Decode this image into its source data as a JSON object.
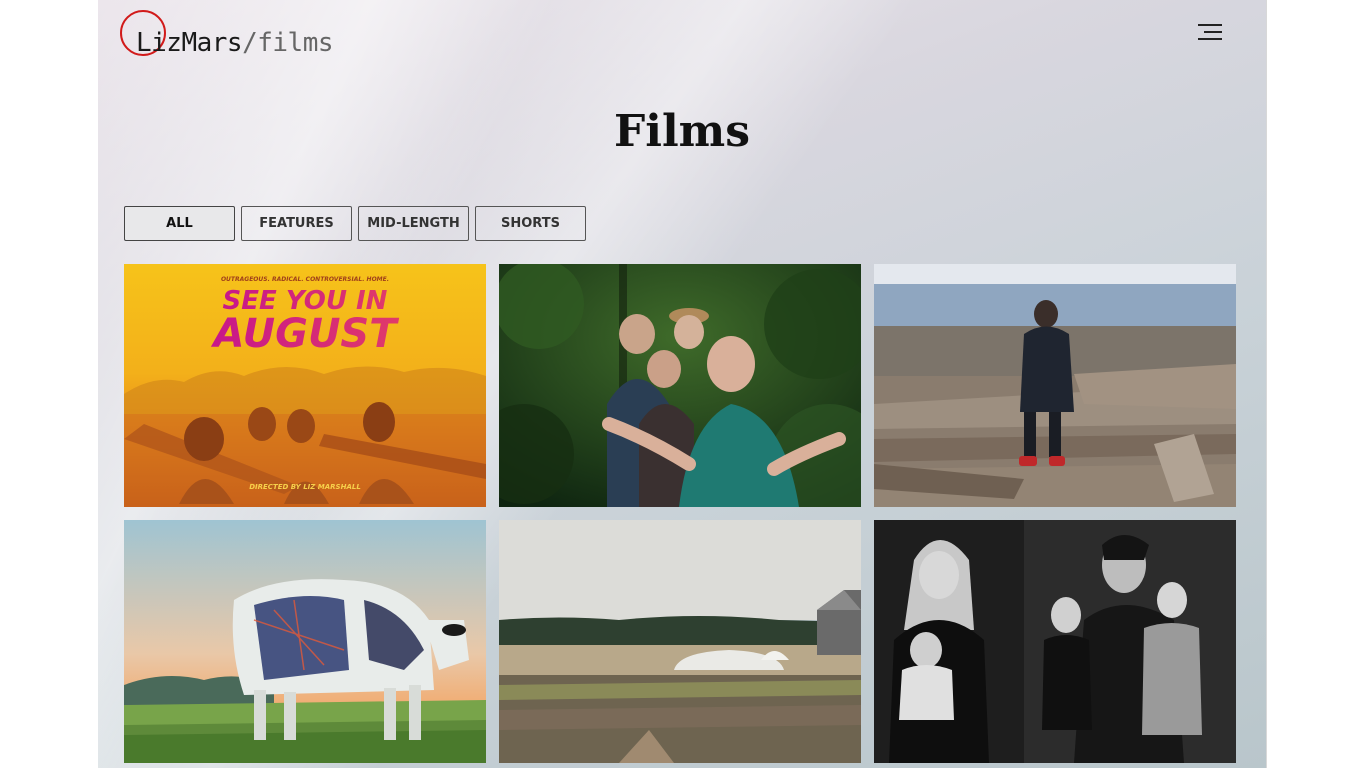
{
  "header": {
    "logo_text": "LizMars",
    "logo_sub": "/films",
    "menu_icon": "hamburger-menu-icon",
    "logo_ring_color": "#d11a1a"
  },
  "page": {
    "title": "Films"
  },
  "filters": [
    {
      "label": "ALL",
      "active": true
    },
    {
      "label": "FEATURES",
      "active": false
    },
    {
      "label": "MID-LENGTH",
      "active": false
    },
    {
      "label": "SHORTS",
      "active": false
    }
  ],
  "films": [
    {
      "poster_tagline": "OUTRAGEOUS. RADICAL. CONTROVERSIAL. HOME.",
      "poster_title_line1": "SEE YOU IN",
      "poster_title_line2": "AUGUST",
      "poster_credit": "DIRECTED BY LIZ MARSHALL",
      "description": "yellow-tinted poster of teenagers lying in canoes"
    },
    {
      "description": "elderly people in a forest, man with outstretched hands"
    },
    {
      "description": "person standing on driftwood logs on a rocky beach"
    },
    {
      "description": "cow painted with a star map standing in a grassy field at sunset"
    },
    {
      "description": "farm field with greenhouses and a barn"
    },
    {
      "description": "black and white family portrait with two young children"
    }
  ]
}
